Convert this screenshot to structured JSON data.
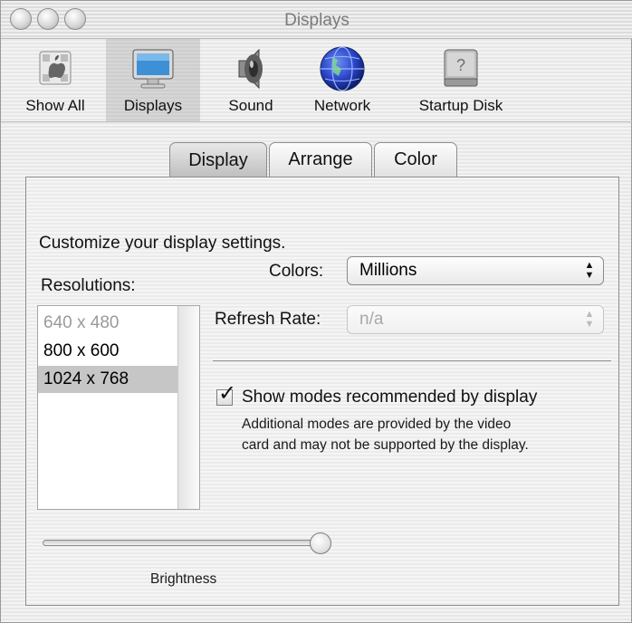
{
  "window": {
    "title": "Displays"
  },
  "toolbar": {
    "items": [
      {
        "label": "Show All",
        "icon": "apple-icon"
      },
      {
        "label": "Displays",
        "icon": "monitor-icon"
      },
      {
        "label": "Sound",
        "icon": "speaker-icon"
      },
      {
        "label": "Network",
        "icon": "globe-icon"
      },
      {
        "label": "Startup Disk",
        "icon": "hard-disk-icon"
      }
    ],
    "selected": "Displays"
  },
  "tabs": [
    {
      "label": "Display",
      "active": true
    },
    {
      "label": "Arrange",
      "active": false
    },
    {
      "label": "Color",
      "active": false
    }
  ],
  "panel": {
    "heading": "Customize your display settings.",
    "resolutions_label": "Resolutions:",
    "resolutions": [
      {
        "label": "640 x 480",
        "enabled": false,
        "selected": false
      },
      {
        "label": "800 x 600",
        "enabled": true,
        "selected": false
      },
      {
        "label": "1024 x 768",
        "enabled": true,
        "selected": true
      }
    ],
    "colors_label": "Colors:",
    "colors_value": "Millions",
    "refresh_label": "Refresh Rate:",
    "refresh_value": "n/a",
    "show_modes_label": "Show modes recommended by display",
    "show_modes_checked": true,
    "note_line1": "Additional modes are provided by the video",
    "note_line2": "card and may not be supported by the display.",
    "brightness_label": "Brightness",
    "brightness_value": 1.0
  },
  "colors": {
    "selection": "#c6c6c6",
    "globe": "#2a45c8"
  }
}
